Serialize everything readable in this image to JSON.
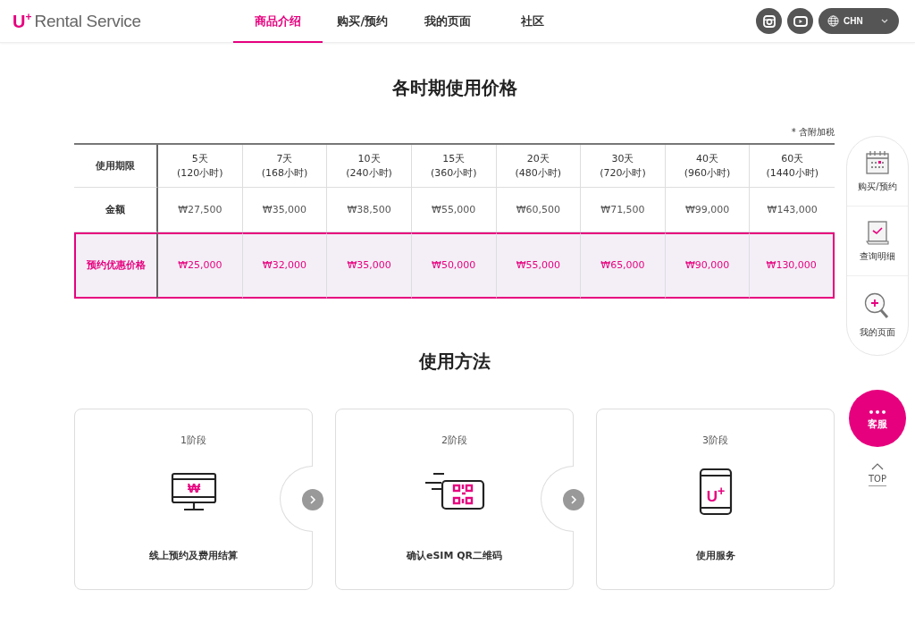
{
  "header": {
    "logo": "U$^{+}$",
    "brand": "Rental Service",
    "nav": [
      {
        "label": "商品介绍",
        "selected": true
      },
      {
        "label": "购买/预约",
        "selected": false
      },
      {
        "label": "我的页面",
        "selected": false
      },
      {
        "label": "社区",
        "selected": false
      }
    ],
    "language": "CHN"
  },
  "pricing": {
    "title": "各时期使用价格",
    "note": "* 含附加税",
    "columns": [
      "使用期限",
      "5天\n(120小时)",
      "7天\n(168小时)",
      "10天\n(240小时)",
      "15天\n(360小时)",
      "20天\n(480小时)",
      "30天\n(720小时)",
      "40天\n(960小时)",
      "60天\n(1440小时)"
    ],
    "rows": [
      {
        "highlighted": false,
        "cells": [
          "金额",
          "₩27,500",
          "₩35,000",
          "₩38,500",
          "₩55,000",
          "₩60,500",
          "₩71,500",
          "₩99,000",
          "₩143,000"
        ]
      },
      {
        "highlighted": true,
        "cells": [
          "预约优惠价格",
          "₩25,000",
          "₩32,000",
          "₩35,000",
          "₩50,000",
          "₩55,000",
          "₩65,000",
          "₩90,000",
          "₩130,000"
        ]
      }
    ]
  },
  "usage": {
    "title": "使用方法",
    "steps": [
      {
        "stage": "1阶段",
        "kind": "monitor",
        "icon_text": "₩",
        "label": "线上预约及费用结算"
      },
      {
        "stage": "2阶段",
        "kind": "qr",
        "label": "确认eSIM QR二维码"
      },
      {
        "stage": "3阶段",
        "kind": "phone",
        "icon_text": "U$^{+}$",
        "label": "使用服务"
      }
    ]
  },
  "quick_menu": [
    {
      "kind": "calendar",
      "label": "购买/预约"
    },
    {
      "kind": "report",
      "label": "查询明细"
    },
    {
      "kind": "search",
      "label": "我的页面"
    }
  ],
  "chat": {
    "dots": "•••",
    "label": "客服"
  },
  "top": "TOP"
}
